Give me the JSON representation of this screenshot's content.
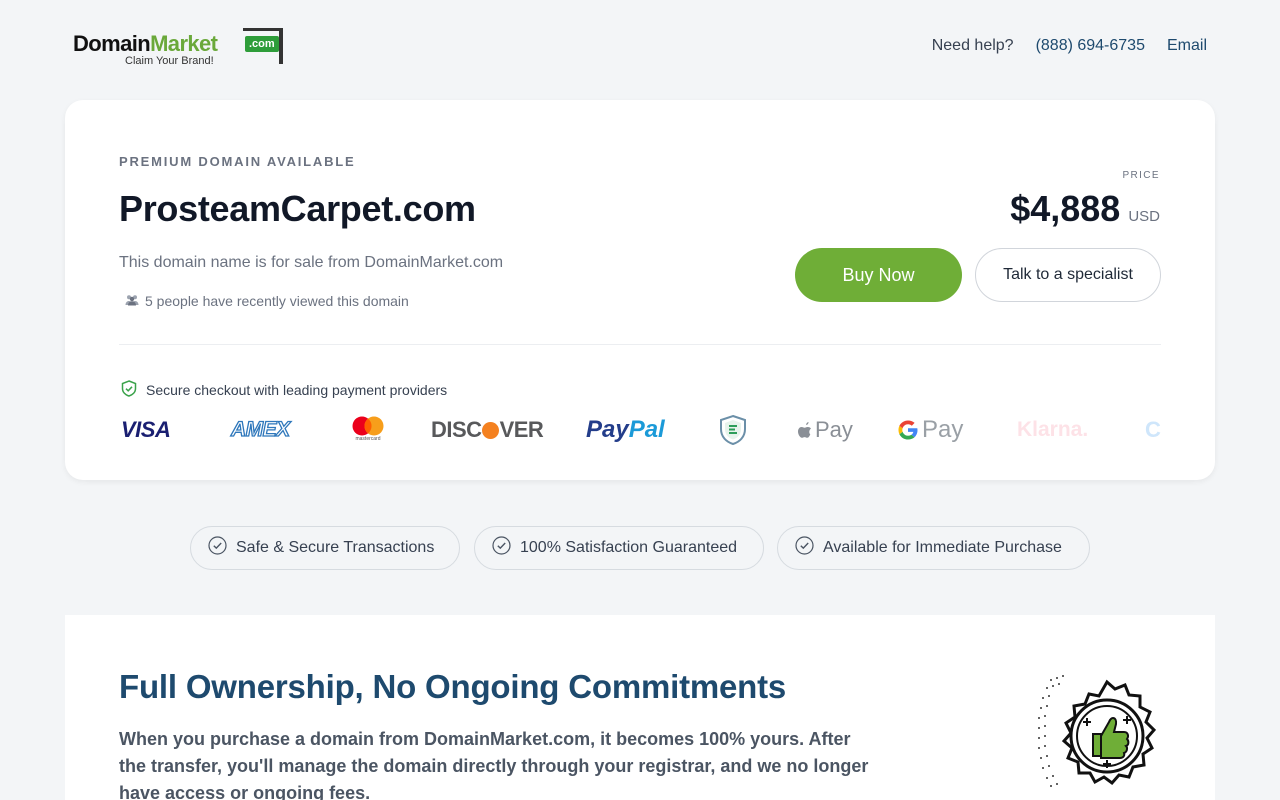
{
  "header": {
    "logo": {
      "domain": "Domain",
      "market": "Market",
      "com": ".com",
      "tagline": "Claim Your Brand!"
    },
    "nav": {
      "help": "Need help?",
      "phone": "(888) 694-6735",
      "email": "Email"
    }
  },
  "card": {
    "eyebrow": "PREMIUM DOMAIN AVAILABLE",
    "domain": "ProsteamCarpet.com",
    "sale_text": "This domain name is for sale from DomainMarket.com",
    "viewed_text": "5 people have recently viewed this domain",
    "price_label": "PRICE",
    "price": "$4,888",
    "currency": "USD",
    "buy_label": "Buy Now",
    "talk_label": "Talk to a specialist",
    "secure_text": "Secure checkout with leading payment providers",
    "payments": {
      "visa": "VISA",
      "amex": "AMEX",
      "mastercard": "mastercard",
      "discover_a": "DISC",
      "discover_b": "VER",
      "paypal_a": "Pay",
      "paypal_b": "Pal",
      "apple": "Pay",
      "google": "Pay",
      "klarna": "Klarna.",
      "crypto": "C"
    }
  },
  "trust": [
    {
      "label": "Safe & Secure Transactions"
    },
    {
      "label": "100% Satisfaction Guaranteed"
    },
    {
      "label": "Available for Immediate Purchase"
    }
  ],
  "ownership": {
    "title": "Full Ownership, No Ongoing Commitments",
    "body": "When you purchase a domain from DomainMarket.com, it becomes 100% yours. After the transfer, you'll manage the domain directly through your registrar, and we no longer have access or ongoing fees."
  },
  "colors": {
    "brand_green": "#6fae37",
    "heading_blue": "#1e4a6e",
    "page_bg": "#f3f5f7"
  }
}
